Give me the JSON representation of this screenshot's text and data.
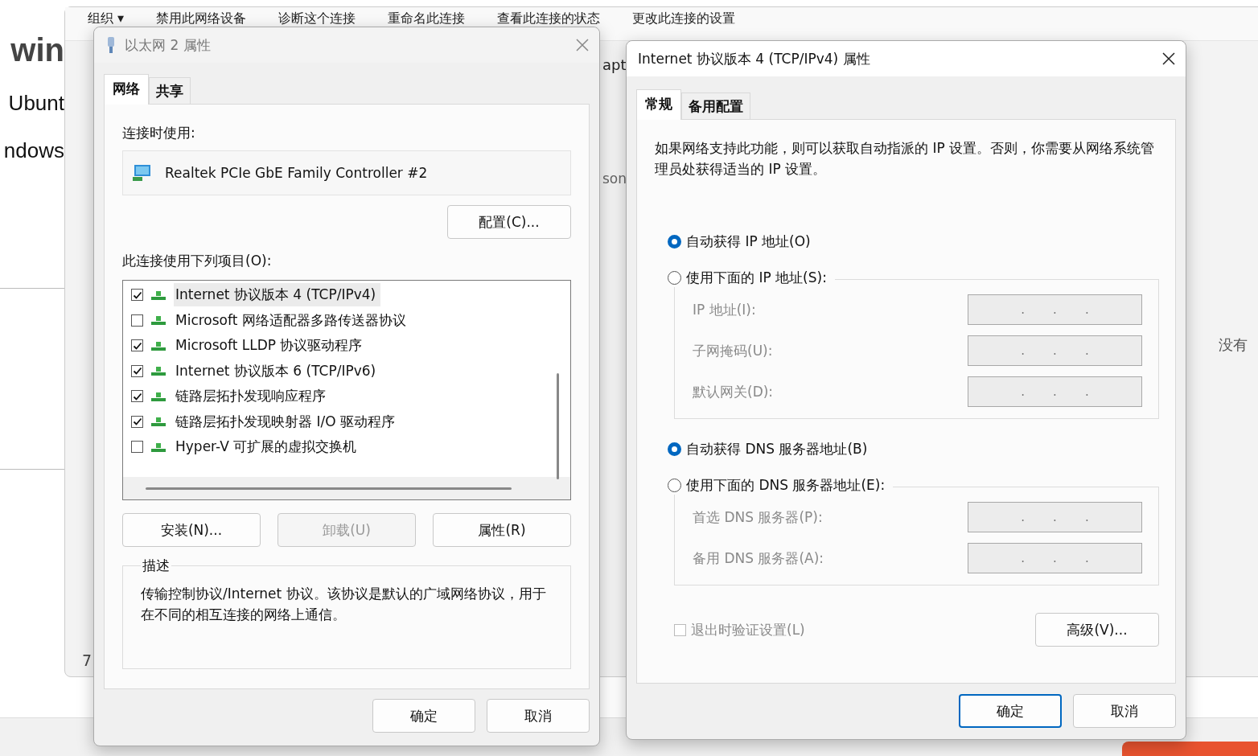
{
  "background_page": {
    "fragments": [
      "win",
      "Ubunt",
      "ndows"
    ]
  },
  "explorer": {
    "toolbar": [
      "组织 ▾",
      "禁用此网络设备",
      "诊断这个连接",
      "重命名此连接",
      "查看此连接的状态",
      "更改此连接的设置"
    ],
    "fragments": [
      "apt",
      "son"
    ],
    "footer_count": "7",
    "preview_text": "没有"
  },
  "adapter_dialog": {
    "title": "以太网 2 属性",
    "tabs": [
      {
        "label": "网络",
        "selected": true
      },
      {
        "label": "共享",
        "selected": false
      }
    ],
    "connect_using_label": "连接时使用:",
    "adapter_name": "Realtek PCIe GbE Family Controller #2",
    "configure_button": "配置(C)...",
    "items_label": "此连接使用下列项目(O):",
    "items": [
      {
        "label": "Internet 协议版本 4 (TCP/IPv4)",
        "checked": true,
        "selected": true
      },
      {
        "label": "Microsoft 网络适配器多路传送器协议",
        "checked": false,
        "selected": false
      },
      {
        "label": "Microsoft LLDP 协议驱动程序",
        "checked": true,
        "selected": false
      },
      {
        "label": "Internet 协议版本 6 (TCP/IPv6)",
        "checked": true,
        "selected": false
      },
      {
        "label": "链路层拓扑发现响应程序",
        "checked": true,
        "selected": false
      },
      {
        "label": "链路层拓扑发现映射器 I/O 驱动程序",
        "checked": true,
        "selected": false
      },
      {
        "label": "Hyper-V 可扩展的虚拟交换机",
        "checked": false,
        "selected": false
      }
    ],
    "buttons": [
      {
        "label": "安装(N)...",
        "disabled": false
      },
      {
        "label": "卸载(U)",
        "disabled": true
      },
      {
        "label": "属性(R)",
        "disabled": false
      }
    ],
    "description": {
      "title": "描述",
      "text": "传输控制协议/Internet 协议。该协议是默认的广域网络协议，用于在不同的相互连接的网络上通信。"
    },
    "footer_buttons": [
      "确定",
      "取消"
    ]
  },
  "ipv4_dialog": {
    "title": "Internet 协议版本 4 (TCP/IPv4) 属性",
    "tabs": [
      {
        "label": "常规",
        "selected": true
      },
      {
        "label": "备用配置",
        "selected": false
      }
    ],
    "intro": "如果网络支持此功能，则可以获取自动指派的 IP 设置。否则，你需要从网络系统管理员处获得适当的 IP 设置。",
    "ip_options": [
      {
        "label": "自动获得 IP 地址(O)",
        "selected": true
      },
      {
        "label": "使用下面的 IP 地址(S):",
        "selected": false
      }
    ],
    "ip_fields": [
      {
        "label": "IP 地址(I):",
        "dots": [
          ".",
          ".",
          "."
        ]
      },
      {
        "label": "子网掩码(U):",
        "dots": [
          ".",
          ".",
          "."
        ]
      },
      {
        "label": "默认网关(D):",
        "dots": [
          ".",
          ".",
          "."
        ]
      }
    ],
    "dns_options": [
      {
        "label": "自动获得 DNS 服务器地址(B)",
        "selected": true
      },
      {
        "label": "使用下面的 DNS 服务器地址(E):",
        "selected": false
      }
    ],
    "dns_fields": [
      {
        "label": "首选 DNS 服务器(P):",
        "dots": [
          ".",
          ".",
          "."
        ]
      },
      {
        "label": "备用 DNS 服务器(A):",
        "dots": [
          ".",
          ".",
          "."
        ]
      }
    ],
    "validate": {
      "label": "退出时验证设置(L)",
      "checked": false,
      "disabled": true
    },
    "advanced_button": "高级(V)...",
    "footer_buttons": [
      {
        "label": "确定",
        "default": true
      },
      {
        "label": "取消",
        "default": false
      }
    ]
  }
}
